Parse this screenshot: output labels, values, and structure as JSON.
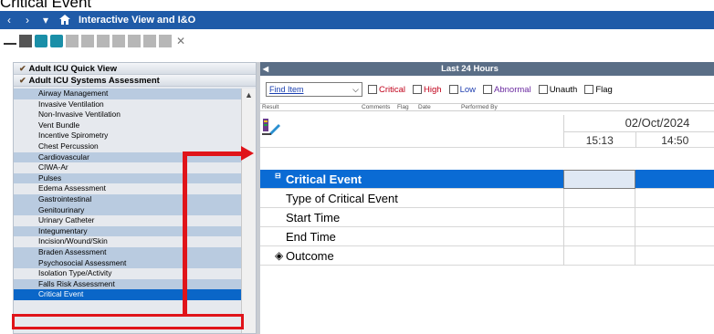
{
  "heading": "Critical Event",
  "window": {
    "title": "Interactive View and I&O",
    "nav_back": "‹",
    "nav_forward": "›",
    "nav_dropdown": "▾"
  },
  "left_panel": {
    "bands": [
      {
        "label": "Adult ICU Quick View"
      },
      {
        "label": "Adult ICU Systems Assessment"
      }
    ],
    "items": [
      {
        "label": "Airway Management",
        "shade": "b"
      },
      {
        "label": "Invasive Ventilation",
        "shade": "l"
      },
      {
        "label": "Non-Invasive Ventilation",
        "shade": "l"
      },
      {
        "label": "Vent Bundle",
        "shade": "l"
      },
      {
        "label": "Incentive Spirometry",
        "shade": "l"
      },
      {
        "label": "Chest Percussion",
        "shade": "l"
      },
      {
        "label": "Cardiovascular",
        "shade": "b"
      },
      {
        "label": "CIWA-Ar",
        "shade": "l"
      },
      {
        "label": "Pulses",
        "shade": "b"
      },
      {
        "label": "Edema Assessment",
        "shade": "l"
      },
      {
        "label": "Gastrointestinal",
        "shade": "b"
      },
      {
        "label": "Genitourinary",
        "shade": "b"
      },
      {
        "label": "Urinary Catheter",
        "shade": "l"
      },
      {
        "label": "Integumentary",
        "shade": "b"
      },
      {
        "label": "Incision/Wound/Skin",
        "shade": "l"
      },
      {
        "label": "Braden Assessment",
        "shade": "b"
      },
      {
        "label": "Psychosocial Assessment",
        "shade": "b"
      },
      {
        "label": "Isolation Type/Activity",
        "shade": "l"
      },
      {
        "label": "Falls Risk Assessment",
        "shade": "b"
      },
      {
        "label": "Critical Event",
        "shade": "sel"
      }
    ]
  },
  "right_panel": {
    "time_range": "Last 24 Hours",
    "find_item": "Find Item",
    "filters": [
      {
        "label": "Critical",
        "kind": "crit"
      },
      {
        "label": "High",
        "kind": "high"
      },
      {
        "label": "Low",
        "kind": "low"
      },
      {
        "label": "Abnormal",
        "kind": "abn"
      },
      {
        "label": "Unauth",
        "kind": "norm"
      },
      {
        "label": "Flag",
        "kind": "norm"
      }
    ],
    "result_columns": [
      "Result",
      "Comments",
      "Flag",
      "Date",
      "Performed By"
    ],
    "date": "02/Oct/2024",
    "times": [
      "15:13",
      "14:50"
    ],
    "rows": [
      {
        "label": "Critical Event",
        "selected": true
      },
      {
        "label": "Type of Critical Event",
        "selected": false
      },
      {
        "label": "Start Time",
        "selected": false
      },
      {
        "label": "End Time",
        "selected": false
      },
      {
        "label": "Outcome",
        "selected": false
      }
    ]
  },
  "colors": {
    "titlebar": "#1f5ba8",
    "selection": "#0a6bd4",
    "annotation": "#e0141a"
  }
}
